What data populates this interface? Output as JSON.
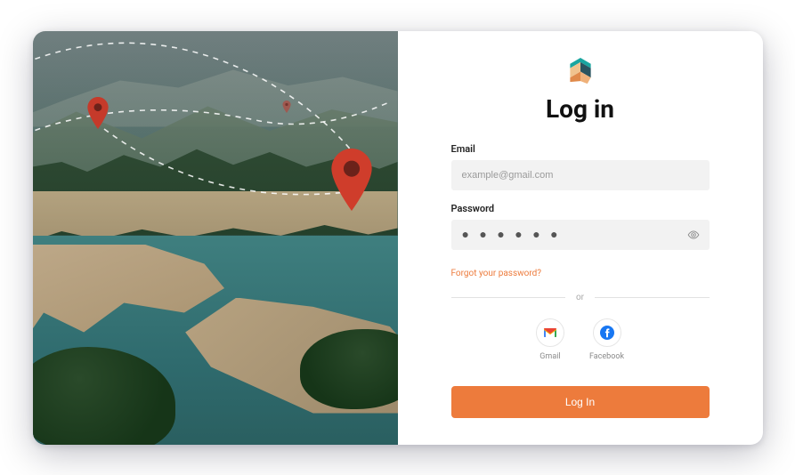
{
  "title": "Log in",
  "email": {
    "label": "Email",
    "placeholder": "example@gmail.com",
    "value": ""
  },
  "password": {
    "label": "Password",
    "masked": "● ● ● ● ● ●"
  },
  "forgot_link": "Forgot your password?",
  "divider": "or",
  "social": {
    "gmail": "Gmail",
    "facebook": "Facebook"
  },
  "login_button": "Log In"
}
